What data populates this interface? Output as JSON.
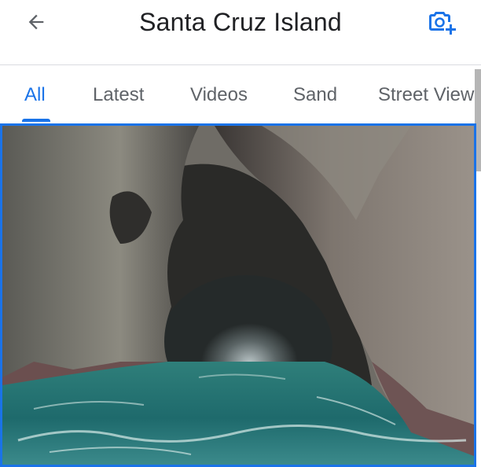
{
  "header": {
    "title": "Santa Cruz Island",
    "back_icon": "arrow-left-icon",
    "add_photo_icon": "add-photo-icon"
  },
  "tabs": [
    {
      "label": "All",
      "active": true
    },
    {
      "label": "Latest",
      "active": false
    },
    {
      "label": "Videos",
      "active": false
    },
    {
      "label": "Sand",
      "active": false
    },
    {
      "label": "Street View",
      "active": false
    }
  ],
  "colors": {
    "accent": "#1a73e8",
    "text": "#202124",
    "muted": "#5f6368",
    "divider": "#dadce0"
  }
}
